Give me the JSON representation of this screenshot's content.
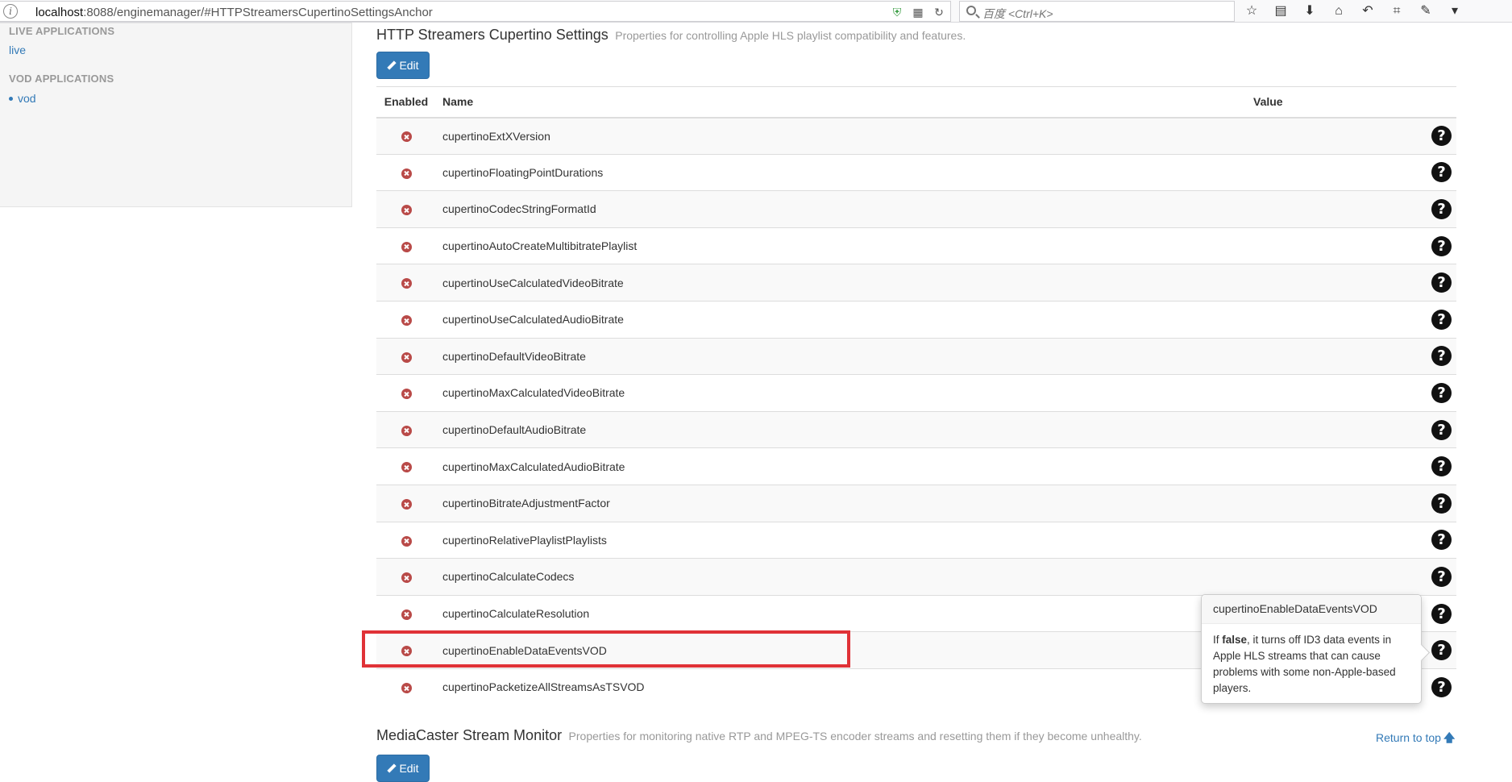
{
  "browser": {
    "url_host": "localhost",
    "url_rest": ":8088/enginemanager/#HTTPStreamersCupertinoSettingsAnchor",
    "search_placeholder": "百度 <Ctrl+K>"
  },
  "sidebar": {
    "live_heading": "LIVE APPLICATIONS",
    "live_items": [
      "live"
    ],
    "vod_heading": "VOD APPLICATIONS",
    "vod_items": [
      "vod"
    ]
  },
  "panel": {
    "title": "HTTP Streamers Cupertino Settings",
    "subtitle": "Properties for controlling Apple HLS playlist compatibility and features.",
    "edit_label": "Edit",
    "columns": {
      "enabled": "Enabled",
      "name": "Name",
      "value": "Value"
    },
    "help_glyph": "?",
    "rows": [
      {
        "name": "cupertinoExtXVersion"
      },
      {
        "name": "cupertinoFloatingPointDurations"
      },
      {
        "name": "cupertinoCodecStringFormatId"
      },
      {
        "name": "cupertinoAutoCreateMultibitratePlaylist"
      },
      {
        "name": "cupertinoUseCalculatedVideoBitrate"
      },
      {
        "name": "cupertinoUseCalculatedAudioBitrate"
      },
      {
        "name": "cupertinoDefaultVideoBitrate"
      },
      {
        "name": "cupertinoMaxCalculatedVideoBitrate"
      },
      {
        "name": "cupertinoDefaultAudioBitrate"
      },
      {
        "name": "cupertinoMaxCalculatedAudioBitrate"
      },
      {
        "name": "cupertinoBitrateAdjustmentFactor"
      },
      {
        "name": "cupertinoRelativePlaylistPlaylists"
      },
      {
        "name": "cupertinoCalculateCodecs"
      },
      {
        "name": "cupertinoCalculateResolution"
      },
      {
        "name": "cupertinoEnableDataEventsVOD"
      },
      {
        "name": "cupertinoPacketizeAllStreamsAsTSVOD"
      }
    ]
  },
  "popover": {
    "title": "cupertinoEnableDataEventsVOD",
    "body_prefix": "If ",
    "body_bold": "false",
    "body_suffix": ", it turns off ID3 data events in Apple HLS streams that can cause problems with some non-Apple-based players."
  },
  "section2": {
    "title": "MediaCaster Stream Monitor",
    "subtitle": "Properties for monitoring native RTP and MPEG-TS encoder streams and resetting them if they become unhealthy.",
    "edit_label": "Edit",
    "return_top": "Return to top",
    "return_arrow": "🡅"
  }
}
